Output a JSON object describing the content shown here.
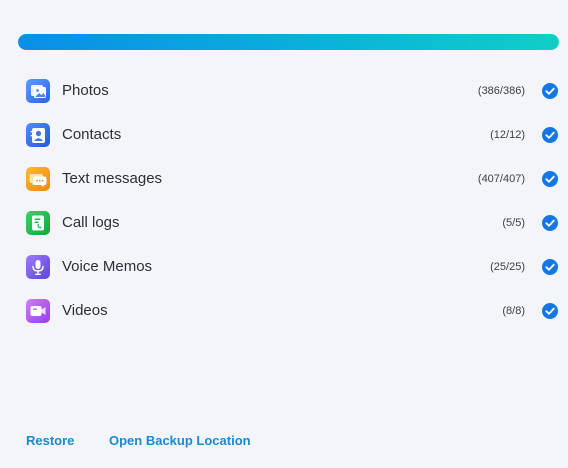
{
  "progress": {
    "fraction": 1.0
  },
  "items": [
    {
      "label": "Photos",
      "count": "(386/386)",
      "icon": "photos-icon",
      "color": "#3d7cf0"
    },
    {
      "label": "Contacts",
      "count": "(12/12)",
      "icon": "contacts-icon",
      "color": "#2f6fe8"
    },
    {
      "label": "Text messages",
      "count": "(407/407)",
      "icon": "text-messages-icon",
      "color": "#f0a020"
    },
    {
      "label": "Call logs",
      "count": "(5/5)",
      "icon": "call-logs-icon",
      "color": "#1fb84a"
    },
    {
      "label": "Voice Memos",
      "count": "(25/25)",
      "icon": "voice-memos-icon",
      "color": "#7e5ce6"
    },
    {
      "label": "Videos",
      "count": "(8/8)",
      "icon": "videos-icon",
      "color": "#b25ae6"
    }
  ],
  "checked": [
    true,
    true,
    true,
    true,
    true,
    true
  ],
  "footer": {
    "restore_label": "Restore",
    "open_location_label": "Open Backup Location"
  },
  "colors": {
    "accent": "#1576e6",
    "link": "#1a8ad0",
    "background": "#f3f5fb"
  }
}
